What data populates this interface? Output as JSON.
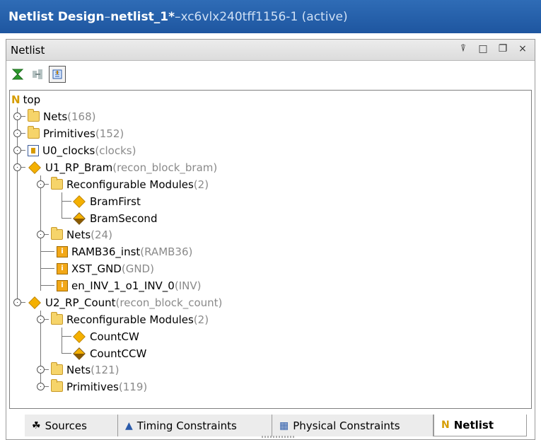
{
  "window": {
    "title_prefix": "Netlist Design",
    "title_sep1": " – ",
    "title_design": "netlist_1",
    "title_modified": " * ",
    "title_sep2": "– ",
    "title_part": "xc6vlx240tff1156-1 (active)"
  },
  "panel": {
    "title": "Netlist",
    "controls": [
      "⍒",
      "□",
      "❐",
      "×"
    ]
  },
  "toolbar": {
    "buttons": [
      "collapse-all",
      "expand-all",
      "show-hierarchy"
    ]
  },
  "tree": [
    {
      "label": "top",
      "suffix": ""
    },
    {
      "label": "Nets",
      "suffix": " (168)"
    },
    {
      "label": "Primitives",
      "suffix": " (152)"
    },
    {
      "label": "U0_clocks",
      "suffix": " (clocks)"
    },
    {
      "label": "U1_RP_Bram",
      "suffix": " (recon_block_bram)"
    },
    {
      "label": "Reconfigurable Modules",
      "suffix": " (2)"
    },
    {
      "label": "BramFirst",
      "suffix": ""
    },
    {
      "label": "BramSecond",
      "suffix": ""
    },
    {
      "label": "Nets",
      "suffix": " (24)"
    },
    {
      "label": "RAMB36_inst",
      "suffix": " (RAMB36)"
    },
    {
      "label": "XST_GND",
      "suffix": " (GND)"
    },
    {
      "label": "en_INV_1_o1_INV_0",
      "suffix": " (INV)"
    },
    {
      "label": "U2_RP_Count",
      "suffix": " (recon_block_count)"
    },
    {
      "label": "Reconfigurable Modules",
      "suffix": " (2)"
    },
    {
      "label": "CountCW",
      "suffix": ""
    },
    {
      "label": "CountCCW",
      "suffix": ""
    },
    {
      "label": "Nets",
      "suffix": " (121)"
    },
    {
      "label": "Primitives",
      "suffix": " (119)"
    }
  ],
  "tabs": [
    {
      "label": "Sources"
    },
    {
      "label": "Timing Constraints"
    },
    {
      "label": "Physical Constraints"
    },
    {
      "label": "Netlist"
    }
  ]
}
